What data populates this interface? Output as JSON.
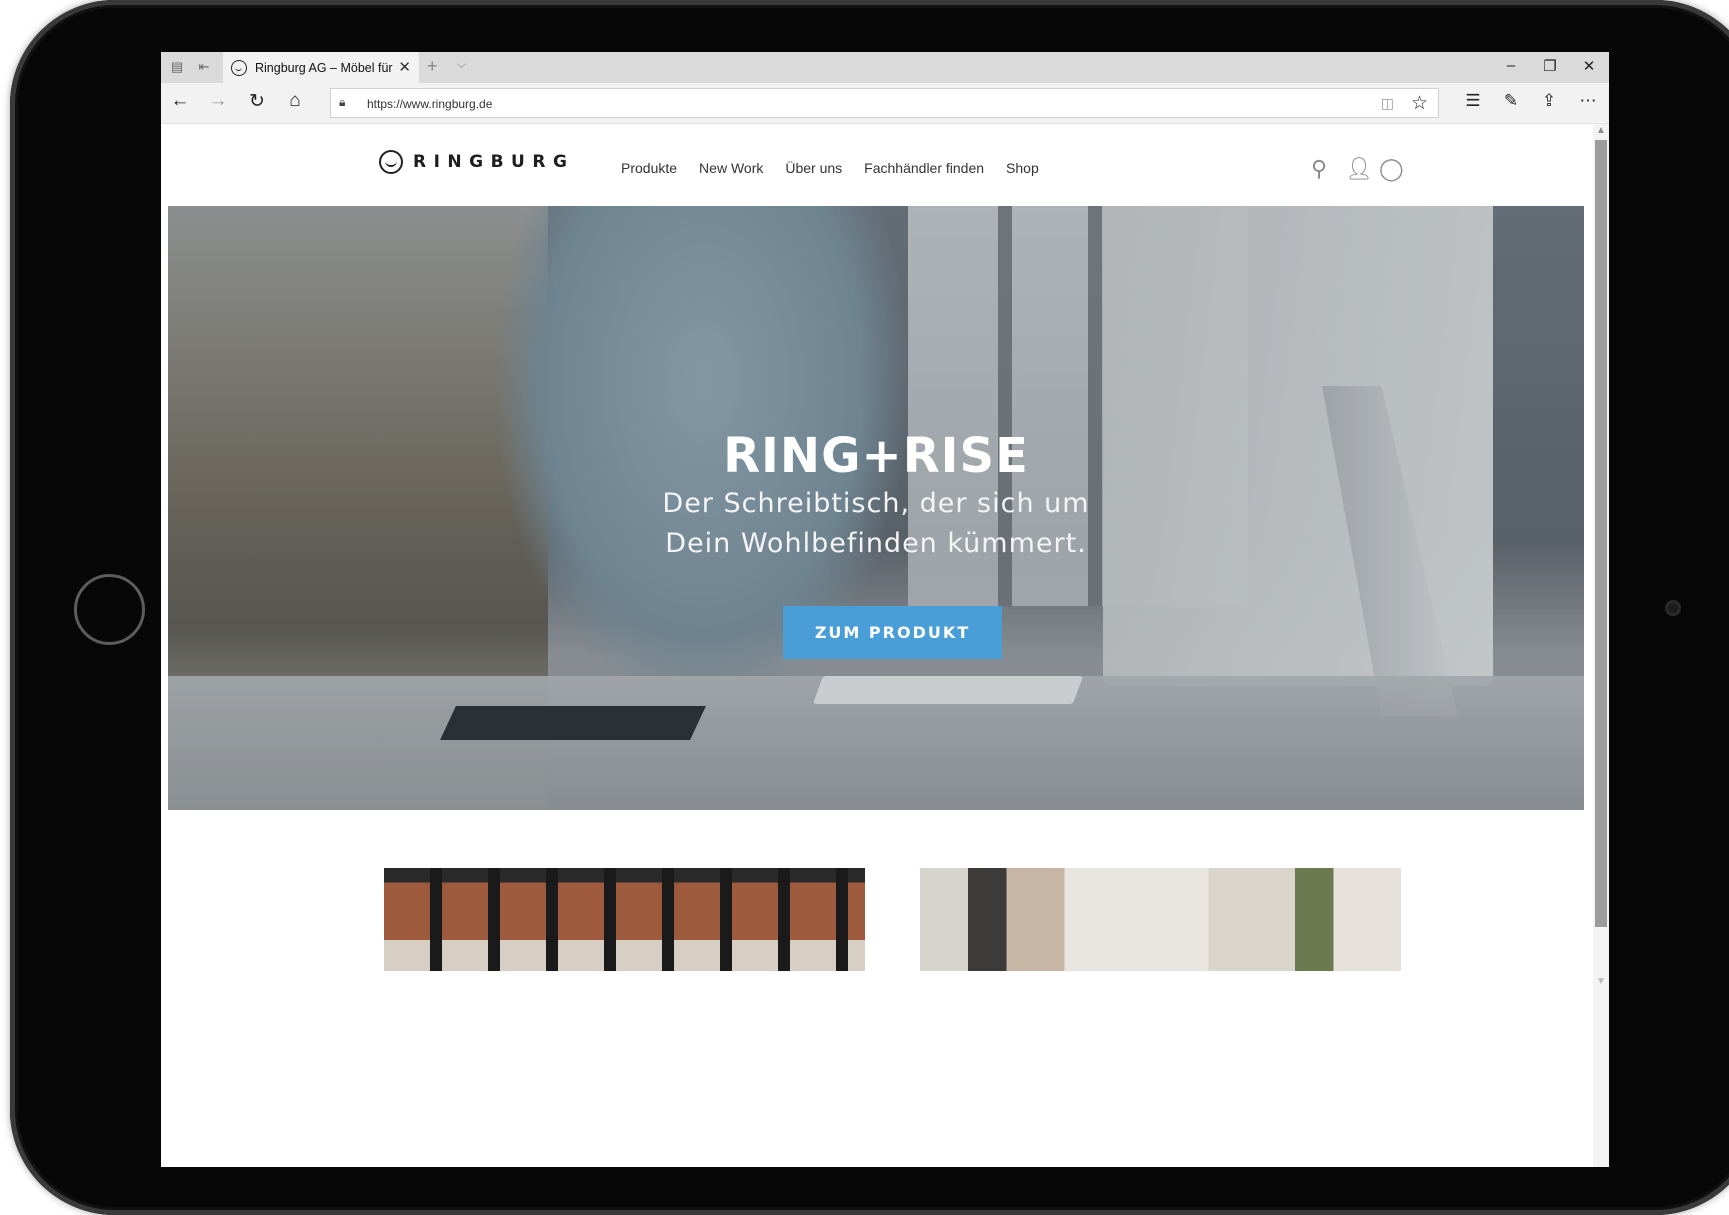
{
  "browser": {
    "tab_title": "Ringburg AG – Möbel für",
    "url": "https://www.ringburg.de"
  },
  "icons": {
    "tab_preview": "tab-preview-icon",
    "set_aside": "set-aside-icon",
    "back": "arrow-left-icon",
    "forward": "arrow-right-icon",
    "refresh": "refresh-icon",
    "home": "home-icon",
    "lock": "lock-icon",
    "reading_view": "reading-view-icon",
    "favorite": "star-icon",
    "favorites_hub": "favorites-list-icon",
    "notes": "pen-icon",
    "share": "share-icon",
    "more": "ellipsis-icon",
    "search": "search-icon",
    "account": "user-icon",
    "chat": "chat-icon"
  },
  "site": {
    "logo": "RINGBURG",
    "nav": [
      "Produkte",
      "New Work",
      "Über uns",
      "Fachhändler finden",
      "Shop"
    ]
  },
  "hero": {
    "title": "RING+RISE",
    "subtitle": "Der Schreibtisch, der sich um Dein Wohlbefinden kümmert.",
    "cta": "ZUM PRODUKT"
  },
  "colors": {
    "accent": "#4a9ed8",
    "text": "#333333"
  }
}
